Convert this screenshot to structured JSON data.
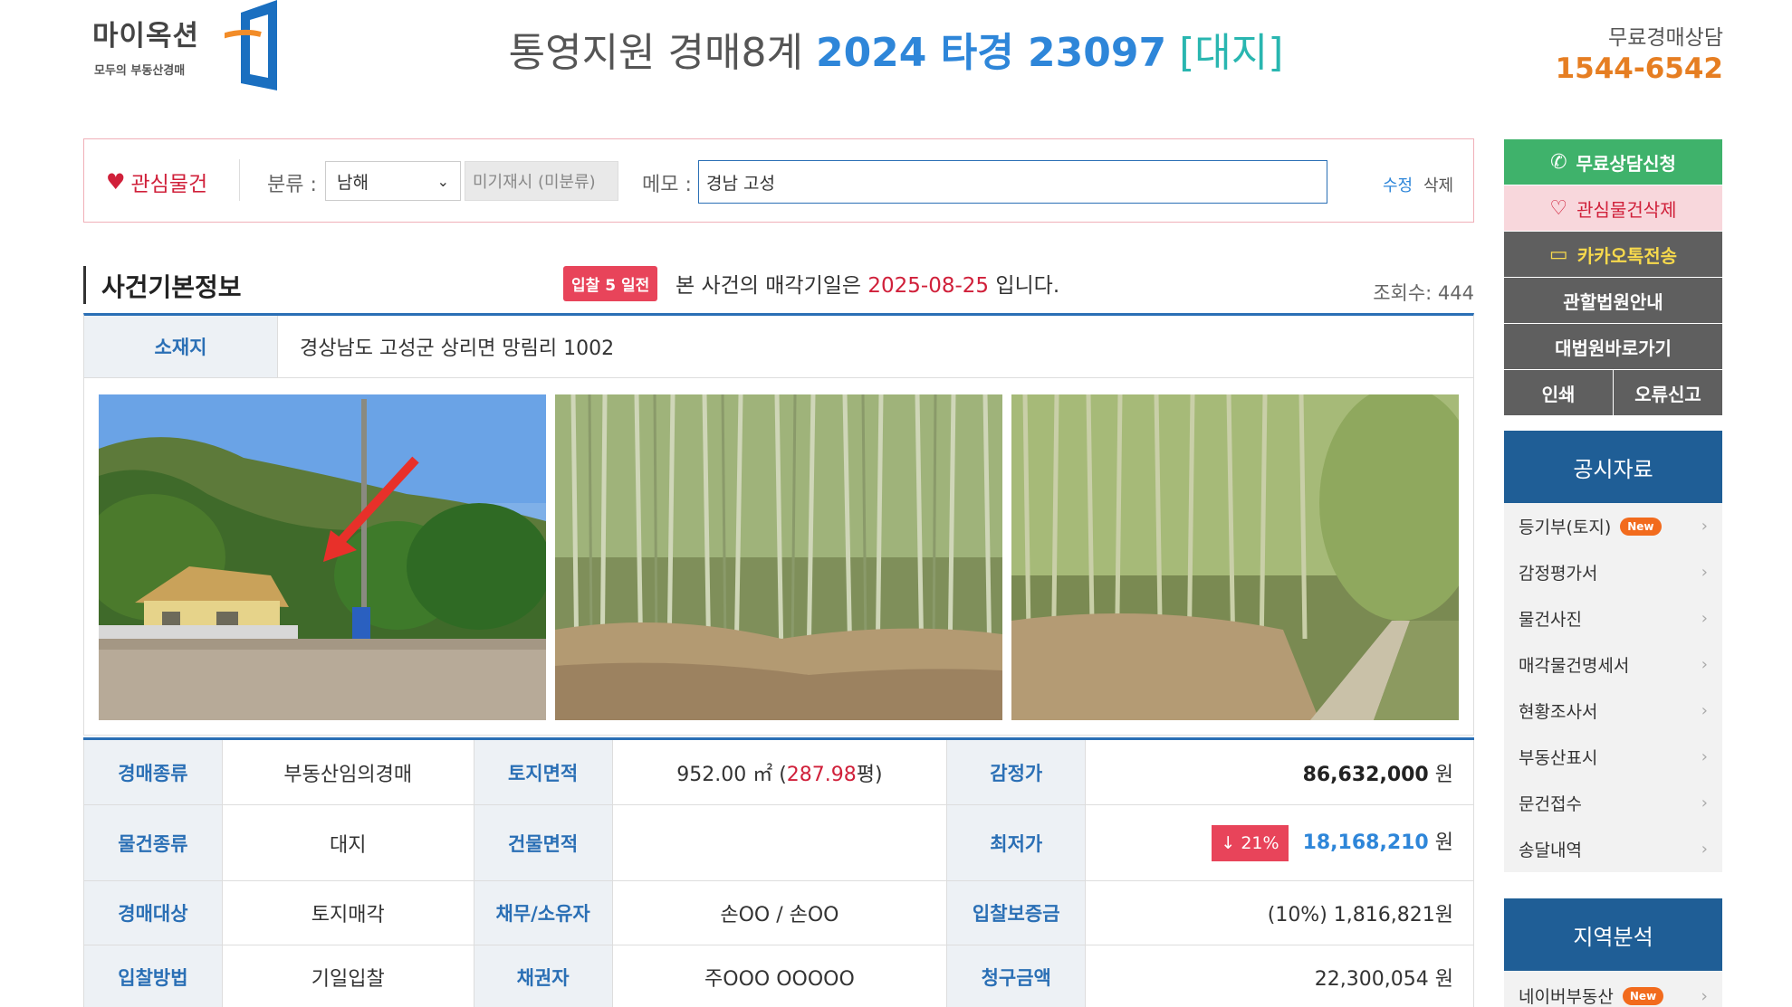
{
  "header": {
    "logo_text": "마이옥션",
    "logo_sub": "모두의 부동산경매",
    "court": "통영지원 경매8계",
    "case_number": "2024 타경 23097",
    "property_kind": "[대지]",
    "consult_label": "무료경매상담",
    "consult_phone": "1544-6542"
  },
  "memo_bar": {
    "favorite_label": "관심물건",
    "category_label": "분류 :",
    "category_selected": "남해",
    "category_input": "미기재시 (미분류)",
    "memo_label": "메모 :",
    "memo_value": "경남 고성",
    "edit_label": "수정",
    "delete_label": "삭제"
  },
  "sidebar": {
    "free_consult": "무료상담신청",
    "remove_favorite": "관심물건삭제",
    "kakao_send": "카카오톡전송",
    "court_info": "관할법원안내",
    "supreme_court": "대법원바로가기",
    "print": "인쇄",
    "report_error": "오류신고",
    "public_docs_title": "공시자료",
    "public_docs": [
      {
        "label": "등기부(토지)",
        "badge": "New"
      },
      {
        "label": "감정평가서",
        "badge": ""
      },
      {
        "label": "물건사진",
        "badge": ""
      },
      {
        "label": "매각물건명세서",
        "badge": ""
      },
      {
        "label": "현황조사서",
        "badge": ""
      },
      {
        "label": "부동산표시",
        "badge": ""
      },
      {
        "label": "문건접수",
        "badge": ""
      },
      {
        "label": "송달내역",
        "badge": ""
      }
    ],
    "region_title": "지역분석",
    "region_first": {
      "label": "네이버부동산",
      "badge": "New"
    }
  },
  "case_info": {
    "section_title": "사건기본정보",
    "days_badge": "입찰 5 일전",
    "notice_pre": "본 사건의 매각기일은 ",
    "sale_date": "2025-08-25",
    "notice_post": " 입니다.",
    "views": "조회수: 444",
    "address_label": "소재지",
    "address": "경상남도 고성군 상리면 망림리 1002"
  },
  "details": {
    "auction_type_label": "경매종류",
    "auction_type": "부동산임의경매",
    "land_area_label": "토지면적",
    "land_area_m2": "952.00 ㎡ (",
    "land_area_py": "287.98",
    "land_area_py_unit": "평)",
    "appraisal_label": "감정가",
    "appraisal": "86,632,000",
    "won": "원",
    "item_type_label": "물건종류",
    "item_type": "대지",
    "building_area_label": "건물면적",
    "building_area": "",
    "min_price_label": "최저가",
    "drop_rate": "↓ 21%",
    "min_price": "18,168,210",
    "target_label": "경매대상",
    "target": "토지매각",
    "debtor_label": "채무/소유자",
    "debtor": "손OO / 손OO",
    "deposit_label": "입찰보증금",
    "deposit": "(10%) 1,816,821원",
    "bid_method_label": "입찰방법",
    "bid_method": "기일입찰",
    "creditor_label": "채권자",
    "creditor": "주OOO OOOOO",
    "claim_label": "청구금액",
    "claim": "22,300,054 원"
  },
  "colors": {
    "primary_blue": "#2a6fb5",
    "accent_red": "#d0203a",
    "badge_pink": "#e8445a",
    "phone_orange": "#e67e22",
    "sidebar_green": "#3fb26b",
    "sidebar_navy": "#1f5e96"
  }
}
